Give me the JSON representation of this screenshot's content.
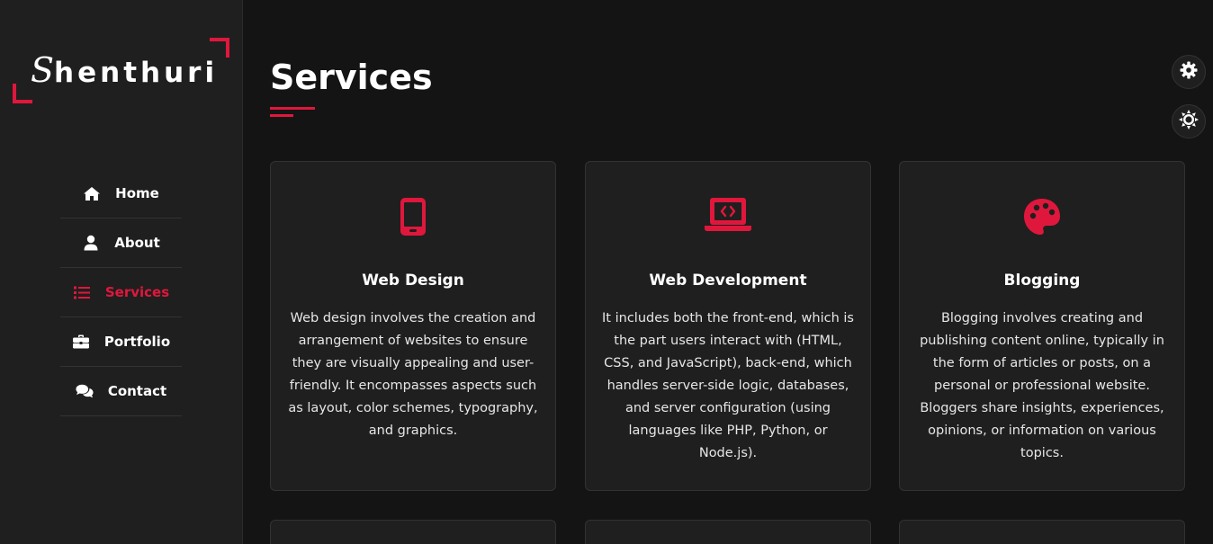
{
  "brand": {
    "logo_initial": "S",
    "logo_rest": "henthuri",
    "accent_color": "#e0173c"
  },
  "nav": {
    "items": [
      {
        "label": "Home",
        "icon": "home-icon",
        "active": false
      },
      {
        "label": "About",
        "icon": "user-icon",
        "active": false
      },
      {
        "label": "Services",
        "icon": "list-icon",
        "active": true
      },
      {
        "label": "Portfolio",
        "icon": "briefcase-icon",
        "active": false
      },
      {
        "label": "Contact",
        "icon": "comments-icon",
        "active": false
      }
    ]
  },
  "main": {
    "title": "Services",
    "cards": [
      {
        "icon": "mobile-icon",
        "title": "Web Design",
        "description": "Web design involves the creation and arrangement of websites to ensure they are visually appealing and user-friendly. It encompasses aspects such as layout, color schemes, typography, and graphics."
      },
      {
        "icon": "laptop-code-icon",
        "title": "Web Development",
        "description": "It includes both the front-end, which is the part users interact with (HTML, CSS, and JavaScript), back-end, which handles server-side logic, databases, and server configuration (using languages like PHP, Python, or Node.js)."
      },
      {
        "icon": "palette-icon",
        "title": "Blogging",
        "description": "Blogging involves creating and publishing content online, typically in the form of articles or posts, on a personal or professional website. Bloggers share insights, experiences, opinions, or information on various topics."
      }
    ]
  },
  "floating_controls": [
    {
      "icon": "gear-icon"
    },
    {
      "icon": "sun-icon"
    }
  ]
}
